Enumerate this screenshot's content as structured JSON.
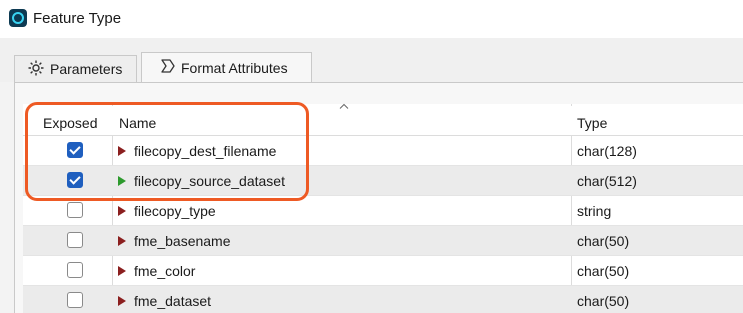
{
  "window": {
    "title": "Feature Type"
  },
  "tabs": [
    {
      "label": "Parameters",
      "icon": "gear-icon",
      "active": false
    },
    {
      "label": "Format Attributes",
      "icon": "sigma-icon",
      "active": true
    }
  ],
  "table": {
    "columns": {
      "exposed": "Exposed",
      "name": "Name",
      "type": "Type"
    },
    "rows": [
      {
        "exposed": true,
        "name": "filecopy_dest_filename",
        "type": "char(128)",
        "marker": "red"
      },
      {
        "exposed": true,
        "name": "filecopy_source_dataset",
        "type": "char(512)",
        "marker": "green"
      },
      {
        "exposed": false,
        "name": "filecopy_type",
        "type": "string",
        "marker": "red"
      },
      {
        "exposed": false,
        "name": "fme_basename",
        "type": "char(50)",
        "marker": "red"
      },
      {
        "exposed": false,
        "name": "fme_color",
        "type": "char(50)",
        "marker": "red"
      },
      {
        "exposed": false,
        "name": "fme_dataset",
        "type": "char(50)",
        "marker": "red"
      }
    ]
  },
  "colors": {
    "highlight": "#ee5a24",
    "checkbox_checked": "#1f5fbf",
    "marker_red": "#8b1f1f",
    "marker_green": "#2d9a2d"
  }
}
